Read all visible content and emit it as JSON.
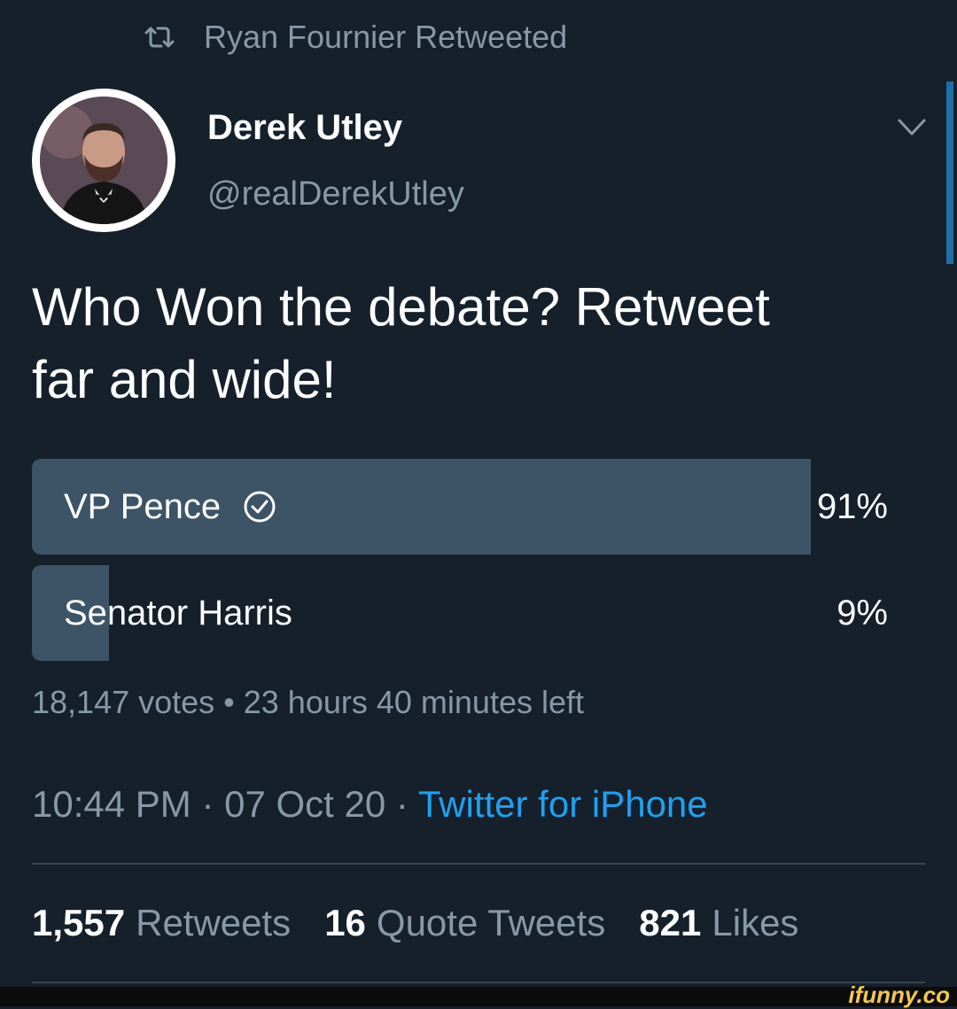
{
  "retweet_header": {
    "icon": "retweet-icon",
    "text": "Ryan Fournier Retweeted"
  },
  "author": {
    "name": "Derek Utley",
    "handle": "@realDerekUtley"
  },
  "tweet": {
    "text_line1": "Who Won the debate? Retweet",
    "text_line2": "far and wide!"
  },
  "poll": {
    "options": [
      {
        "label": "VP Pence",
        "percent_label": "91%",
        "fraction": 0.91,
        "selected": true
      },
      {
        "label": "Senator Harris",
        "percent_label": "9%",
        "fraction": 0.09,
        "selected": false
      }
    ],
    "meta": "18,147 votes • 23 hours 40 minutes left"
  },
  "timestamp": {
    "time": "10:44 PM",
    "date": "07 Oct 20",
    "source": "Twitter for iPhone",
    "separator": "·"
  },
  "stats": [
    {
      "count": "1,557",
      "label": "Retweets"
    },
    {
      "count": "16",
      "label": "Quote Tweets"
    },
    {
      "count": "821",
      "label": "Likes"
    }
  ],
  "watermark": "ifunny.co",
  "colors": {
    "background": "#15202b",
    "poll_fill": "#3d5466",
    "link": "#1da1f2",
    "secondary_text": "#8899a6"
  }
}
